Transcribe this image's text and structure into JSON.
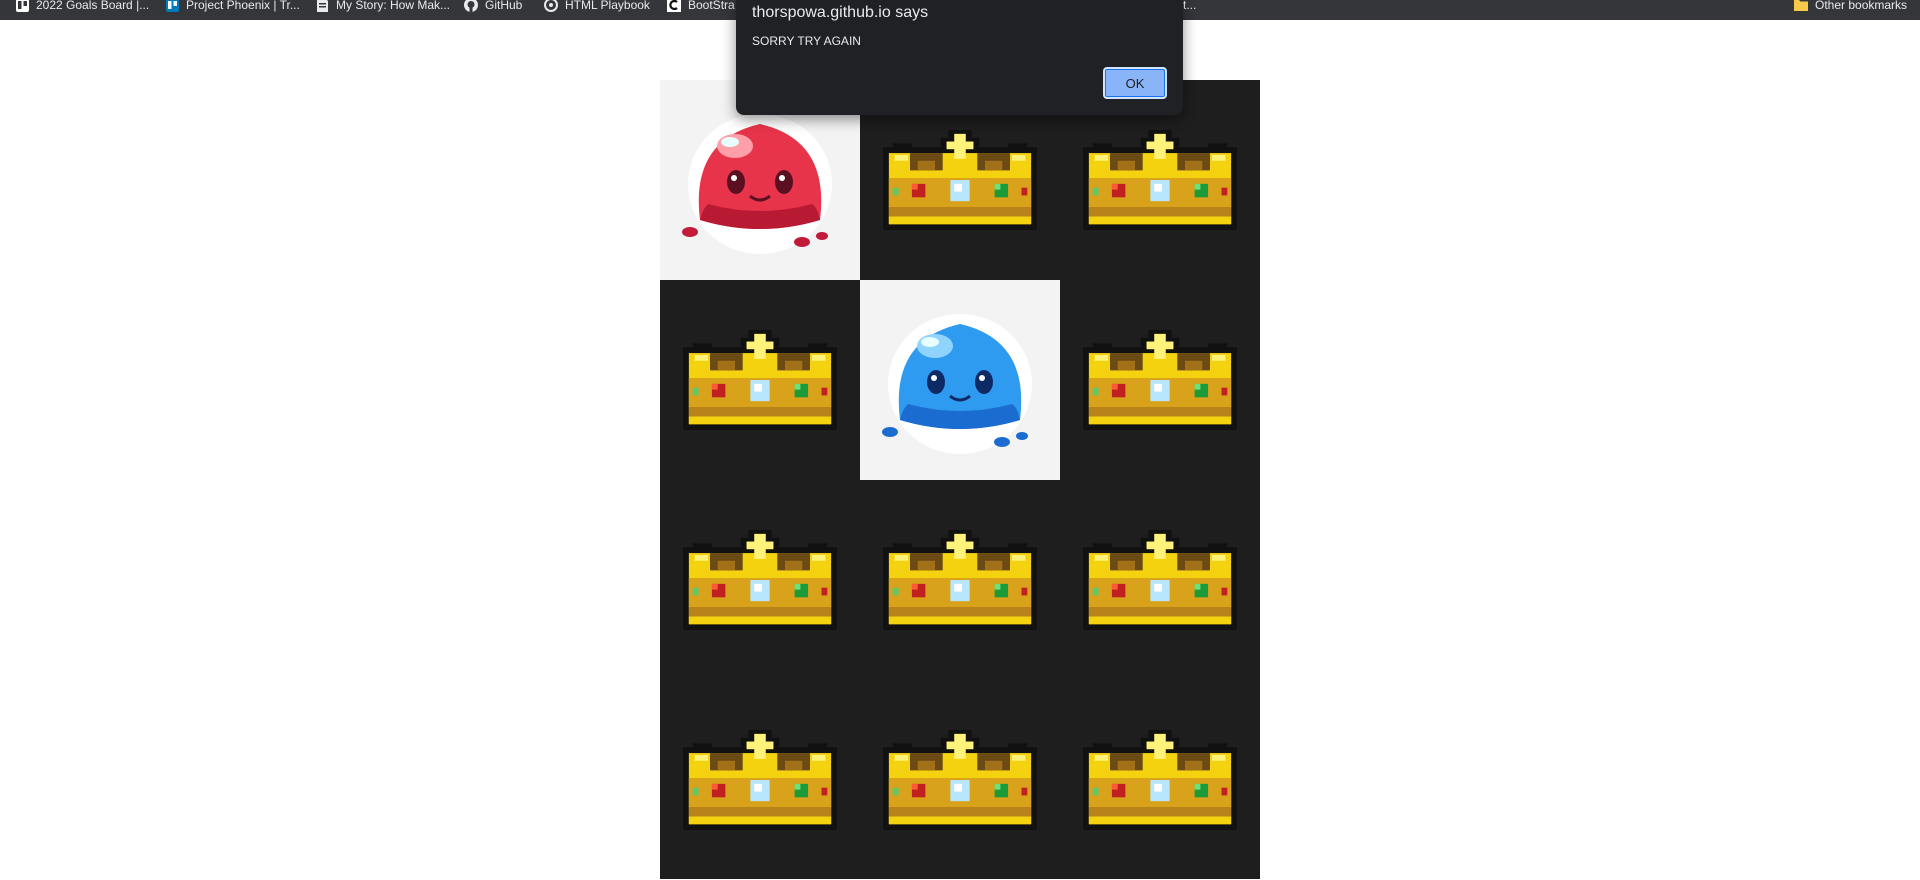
{
  "bookmarks": [
    {
      "label": "2022 Goals Board |...",
      "icon": "trello-icon"
    },
    {
      "label": "Project Phoenix | Tr...",
      "icon": "trello-icon"
    },
    {
      "label": "My Story: How Mak...",
      "icon": "document-icon"
    },
    {
      "label": "GitHub",
      "icon": "github-icon"
    },
    {
      "label": "HTML Playbook",
      "icon": "playbook-icon"
    },
    {
      "label": "BootStra",
      "icon": "codecademy-icon"
    },
    {
      "label": "t...",
      "icon": "bookmark-icon"
    }
  ],
  "other_bookmarks": {
    "label": "Other bookmarks",
    "icon": "folder-icon"
  },
  "dialog": {
    "title": "thorspowa.github.io says",
    "message": "SORRY TRY AGAIN",
    "ok_label": "OK"
  },
  "board": {
    "columns": 3,
    "rows": 4,
    "tiles": [
      {
        "content": "red-slime"
      },
      {
        "content": "crown"
      },
      {
        "content": "crown"
      },
      {
        "content": "crown"
      },
      {
        "content": "blue-slime"
      },
      {
        "content": "crown"
      },
      {
        "content": "crown"
      },
      {
        "content": "crown"
      },
      {
        "content": "crown"
      },
      {
        "content": "crown"
      },
      {
        "content": "crown"
      },
      {
        "content": "crown"
      }
    ]
  },
  "colors": {
    "chrome_bar": "#35363a",
    "board_background": "#1e1e1e",
    "dialog_background": "#202124",
    "ok_button": "#8ab4f8",
    "crown_gold": "#f5d20f",
    "red_slime": "#e8344a",
    "blue_slime": "#2e9bf0"
  }
}
